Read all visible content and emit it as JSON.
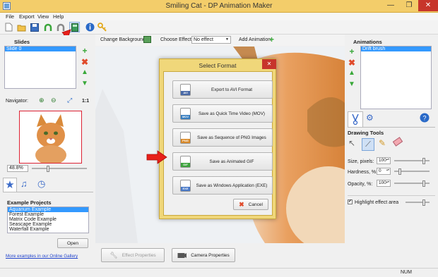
{
  "window": {
    "title": "Smiling Cat - DP Animation Maker",
    "minimize_glyph": "—",
    "restore_glyph": "❐",
    "close_glyph": "✕"
  },
  "menu": {
    "file": "File",
    "export": "Export",
    "view": "View",
    "help": "Help"
  },
  "slides_panel": {
    "header": "Slides",
    "items": [
      "Slide 0"
    ]
  },
  "navigator": {
    "label": "Navigator:",
    "ratio_label": "1:1",
    "zoom_value": "48.8%"
  },
  "projects": {
    "header": "Example Projects",
    "items": [
      "Aquarium Example",
      "Forest Example",
      "Matrix Code Example",
      "Seascape Example",
      "Waterfall Example"
    ],
    "open_label": "Open",
    "gallery_link": "More examples in our Online Gallery"
  },
  "canvas_toolbar": {
    "change_background": "Change Background",
    "choose_effect_label": "Choose Effect:",
    "effect_value": "No effect",
    "add_animation": "Add Animation"
  },
  "bottom_buttons": {
    "effect_properties": "Effect Properties",
    "camera_properties": "Camera Properties"
  },
  "animations_panel": {
    "header": "Animations",
    "items": [
      "Drift brush"
    ]
  },
  "drawing_tools": {
    "header": "Drawing Tools",
    "size_label": "Size, pixels:",
    "size_value": "100",
    "hardness_label": "Hardness, %:",
    "hardness_value": "0",
    "opacity_label": "Opacity, %:",
    "opacity_value": "100",
    "highlight_label": "Highlight effect area",
    "highlight_checked": true
  },
  "dialog": {
    "title": "Select Format",
    "options": [
      {
        "label": "Export to AVI Format",
        "badge": "AVI",
        "badge_color": "#4a6aa8"
      },
      {
        "label": "Save as Quick Time Video (MOV)",
        "badge": "MOV",
        "badge_color": "#3a7fc0"
      },
      {
        "label": "Save as Sequence of PNG Images",
        "badge": "PNG",
        "badge_color": "#d98a2a"
      },
      {
        "label": "Save as Animated GIF",
        "badge": "GIF",
        "badge_color": "#3ea33e"
      },
      {
        "label": "Save as Windows Application (EXE)",
        "badge": "EXE",
        "badge_color": "#4a7ac8"
      }
    ],
    "cancel_label": "Cancel"
  },
  "statusbar": {
    "num": "NUM"
  },
  "colors": {
    "titlebar": "#f3cd6a",
    "selection": "#3399ff",
    "arrow": "#e8201a",
    "dialog_frame": "#f0d77a"
  }
}
